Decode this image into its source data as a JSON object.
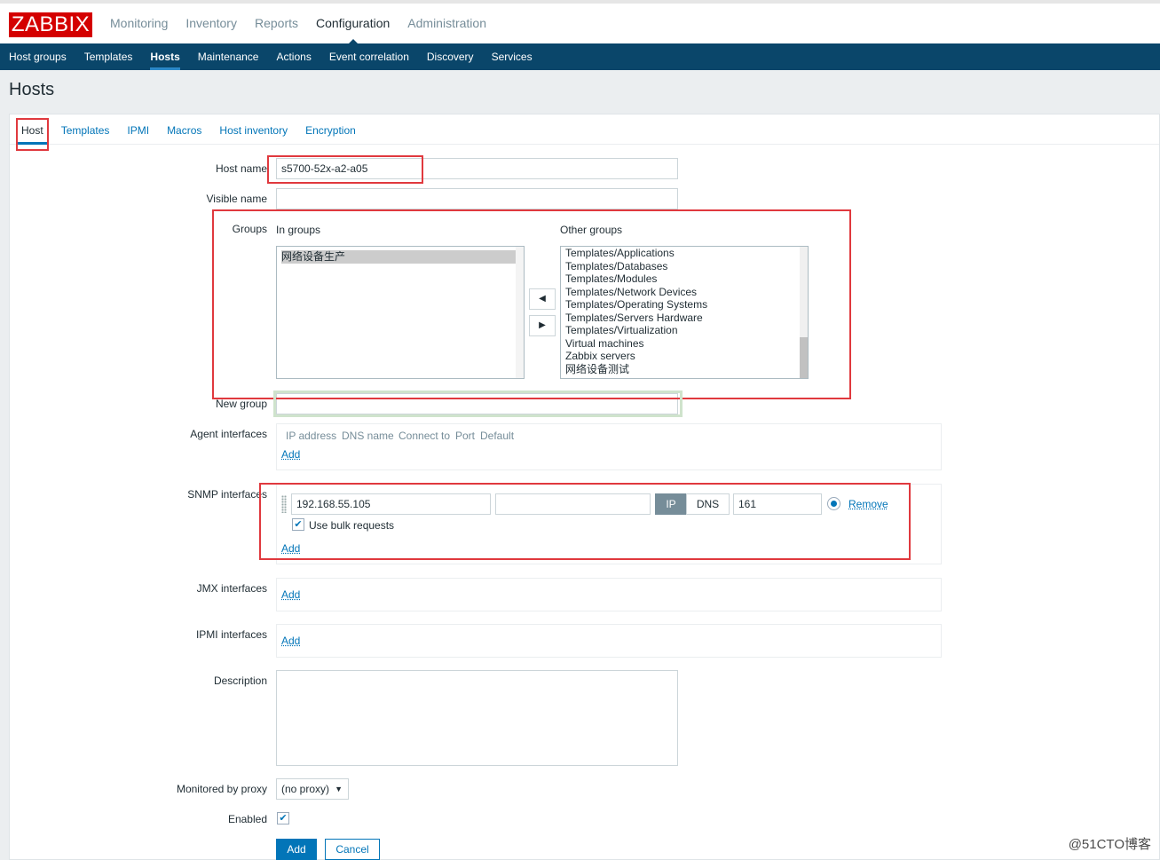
{
  "app": {
    "logo": "ZABBIX"
  },
  "main_nav": [
    {
      "label": "Monitoring",
      "active": false
    },
    {
      "label": "Inventory",
      "active": false
    },
    {
      "label": "Reports",
      "active": false
    },
    {
      "label": "Configuration",
      "active": true
    },
    {
      "label": "Administration",
      "active": false
    }
  ],
  "sub_nav": [
    {
      "label": "Host groups",
      "active": false
    },
    {
      "label": "Templates",
      "active": false
    },
    {
      "label": "Hosts",
      "active": true
    },
    {
      "label": "Maintenance",
      "active": false
    },
    {
      "label": "Actions",
      "active": false
    },
    {
      "label": "Event correlation",
      "active": false
    },
    {
      "label": "Discovery",
      "active": false
    },
    {
      "label": "Services",
      "active": false
    }
  ],
  "page": {
    "title": "Hosts"
  },
  "tabs": [
    {
      "label": "Host",
      "active": true
    },
    {
      "label": "Templates",
      "active": false
    },
    {
      "label": "IPMI",
      "active": false
    },
    {
      "label": "Macros",
      "active": false
    },
    {
      "label": "Host inventory",
      "active": false
    },
    {
      "label": "Encryption",
      "active": false
    }
  ],
  "form": {
    "host_name": {
      "label": "Host name",
      "value": "s5700-52x-a2-a05"
    },
    "visible_name": {
      "label": "Visible name",
      "value": ""
    },
    "groups": {
      "label": "Groups",
      "in_groups_label": "In groups",
      "other_groups_label": "Other groups",
      "in_groups": [
        "网络设备生产"
      ],
      "other_groups": [
        "Templates/Applications",
        "Templates/Databases",
        "Templates/Modules",
        "Templates/Network Devices",
        "Templates/Operating Systems",
        "Templates/Servers Hardware",
        "Templates/Virtualization",
        "Virtual machines",
        "Zabbix servers",
        "网络设备测试"
      ],
      "move_left_icon": "◀",
      "move_right_icon": "▶"
    },
    "new_group": {
      "label": "New group",
      "value": ""
    },
    "agent_interfaces": {
      "label": "Agent interfaces",
      "headers": [
        "IP address",
        "DNS name",
        "Connect to",
        "Port",
        "Default"
      ],
      "add_label": "Add"
    },
    "snmp_interfaces": {
      "label": "SNMP interfaces",
      "ip": "192.168.55.105",
      "dns": "",
      "connect_ip": "IP",
      "connect_dns": "DNS",
      "port": "161",
      "remove_label": "Remove",
      "bulk_label": "Use bulk requests",
      "bulk_checked": true,
      "add_label": "Add"
    },
    "jmx_interfaces": {
      "label": "JMX interfaces",
      "add_label": "Add"
    },
    "ipmi_interfaces": {
      "label": "IPMI interfaces",
      "add_label": "Add"
    },
    "description": {
      "label": "Description",
      "value": ""
    },
    "proxy": {
      "label": "Monitored by proxy",
      "value": "(no proxy)",
      "caret": "▼"
    },
    "enabled": {
      "label": "Enabled",
      "checked": true,
      "check_glyph": "✔"
    },
    "buttons": {
      "add": "Add",
      "cancel": "Cancel"
    }
  },
  "colors": {
    "brand_red": "#d40000",
    "nav_dark": "#0a466a",
    "link_blue": "#0275b8",
    "annotation_red": "#e0393e",
    "annotation_green": "#cfe3cc",
    "toggle_active": "#768d99"
  },
  "watermark": "@51CTO博客"
}
